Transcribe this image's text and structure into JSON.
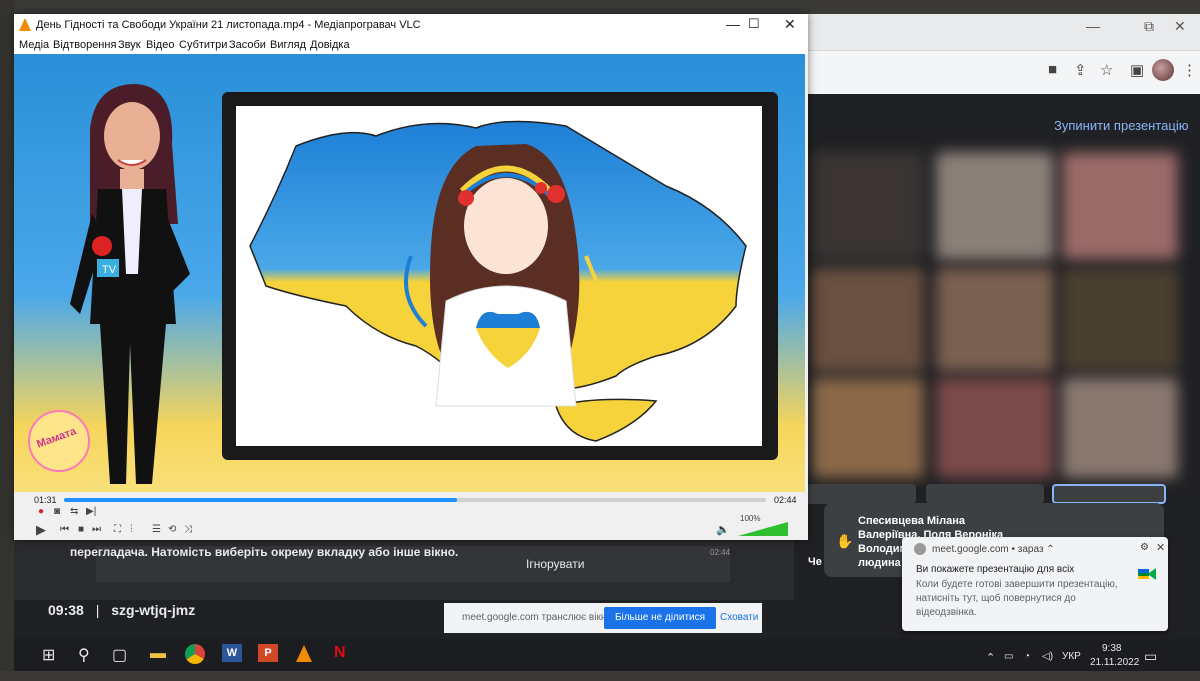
{
  "vlc": {
    "title": "День Гідності та Свободи України 21 листопада.mp4 - Медіапрогравач VLC",
    "menu": [
      "Медіа",
      "Відтворення",
      "Звук",
      "Відео",
      "Субтитри",
      "Засоби",
      "Вигляд",
      "Довідка"
    ],
    "time_elapsed": "01:31",
    "time_total": "02:44",
    "progress": 0.56,
    "volume": "100%",
    "watermark": "Мамата"
  },
  "chrome": {
    "window_controls": [
      "—",
      "⧉",
      "✕"
    ]
  },
  "meet": {
    "stop_presentation": "Зупинити презентацію",
    "banner_text": "перегладача. Натомість виберіть окрему вкладку або інше вікно.",
    "ignore": "Ігнорувати",
    "ghost_time": "02:44",
    "time": "09:38",
    "separator": "|",
    "meeting_code": "szg-wtjq-jmz",
    "participants": [
      "Спесивцева Мілана",
      "Валеріївна, Поля Вероніка",
      "Володим",
      "людина"
    ],
    "participant_cut": "Че",
    "share_text": "meet.google.com транслює вікно.",
    "stop_sharing": "Більше не ділитися",
    "hide": "Сховати"
  },
  "notification": {
    "source": "meet.google.com",
    "when": "зараз",
    "title": "Ви покажете презентацію для всіх",
    "body": "Коли будете готові завершити презентацію, натисніть тут, щоб повернутися до відеодзвінка."
  },
  "taskbar": {
    "time": "9:38",
    "date": "21.11.2022",
    "lang": "УКР"
  },
  "colors": {
    "ukraine_blue": "#1e7fd6",
    "ukraine_yellow": "#f6d33a",
    "meet_link": "#8ab4f8",
    "vlc_progress": "#1e90ff"
  }
}
